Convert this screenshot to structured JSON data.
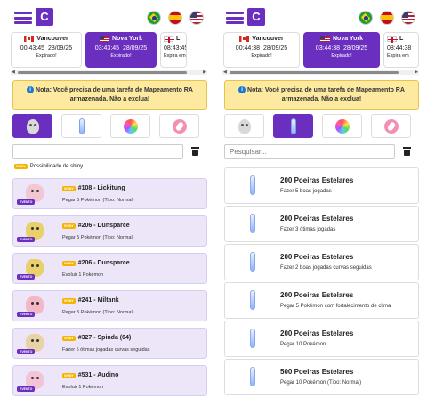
{
  "left": {
    "timezones": [
      {
        "city": "Vancouver",
        "flag": "flag-canada",
        "time": "00:43:45",
        "date": "28/09/25",
        "status": "Expirado!",
        "active": false
      },
      {
        "city": "Nova York",
        "flag": "flag-usa",
        "time": "03:43:45",
        "date": "28/09/25",
        "status": "Expirado!",
        "active": true
      },
      {
        "city": "L",
        "flag": "flag-uk",
        "time": "08:43:45",
        "date": "",
        "status": "Expira em",
        "active": false
      }
    ],
    "note": "Nota: Você precisa de uma tarefa de Mapeamento RA armazenada. Não a exclua!",
    "search_placeholder": "",
    "legend_badge": "SHINY",
    "legend_text": "Possibilidade de shiny.",
    "tasks": [
      {
        "title": "#108 - Lickitung",
        "desc": "Pegar 5 Pokémon (Tipo: Normal)",
        "shiny": "SHINY",
        "event": "EVENTO",
        "sprite_color": "#f1c8d2"
      },
      {
        "title": "#206 - Dunsparce",
        "desc": "Pegar 5 Pokémon (Tipo: Normal)",
        "shiny": "SHINY",
        "event": "EVENTO",
        "sprite_color": "#e8d06a"
      },
      {
        "title": "#206 - Dunsparce",
        "desc": "Evoluir 1 Pokémon",
        "shiny": "SHINY",
        "event": "EVENTO",
        "sprite_color": "#e8d06a"
      },
      {
        "title": "#241 - Miltank",
        "desc": "Pegar 5 Pokémon (Tipo: Normal)",
        "shiny": "SHINY",
        "event": "EVENTO",
        "sprite_color": "#f4b7c6"
      },
      {
        "title": "#327 - Spinda (04)",
        "desc": "Fazer 5 ótimas jogadas curvas seguidas",
        "shiny": "SHINY",
        "event": "EVENTO",
        "sprite_color": "#e7d3a6"
      },
      {
        "title": "#531 - Audino",
        "desc": "Evoluir 1 Pokémon",
        "shiny": "SHINY",
        "event": "EVENTO",
        "sprite_color": "#f2c4d6"
      }
    ]
  },
  "right": {
    "timezones": [
      {
        "city": "Vancouver",
        "flag": "flag-canada",
        "time": "00:44:38",
        "date": "28/09/25",
        "status": "Expirado!",
        "active": false
      },
      {
        "city": "Nova York",
        "flag": "flag-usa",
        "time": "03:44:38",
        "date": "28/09/25",
        "status": "Expirado!",
        "active": true
      },
      {
        "city": "L",
        "flag": "flag-uk",
        "time": "08:44:38",
        "date": "",
        "status": "Expira em",
        "active": false
      }
    ],
    "note": "Nota: Você precisa de uma tarefa de Mapeamento RA armazenada. Não a exclua!",
    "search_placeholder": "Pesquisar...",
    "tasks": [
      {
        "title": "200 Poeiras Estelares",
        "desc": "Fazer 5 boas jogadas"
      },
      {
        "title": "200 Poeiras Estelares",
        "desc": "Fazer 3 ótimas jogadas"
      },
      {
        "title": "200 Poeiras Estelares",
        "desc": "Fazer 2 boas jogadas curvas seguidas"
      },
      {
        "title": "200 Poeiras Estelares",
        "desc": "Pegar 5 Pokémon com fortalecimento de clima"
      },
      {
        "title": "200 Poeiras Estelares",
        "desc": "Pegar 10 Pokémon"
      },
      {
        "title": "500 Poeiras Estelares",
        "desc": "Pegar 10 Pokémon (Tipo: Normal)"
      }
    ]
  },
  "colors": {
    "accent": "#6a2fbf",
    "note_bg": "#fde9a0",
    "event_bg": "#ede6f8",
    "shiny": "#f4b400"
  }
}
